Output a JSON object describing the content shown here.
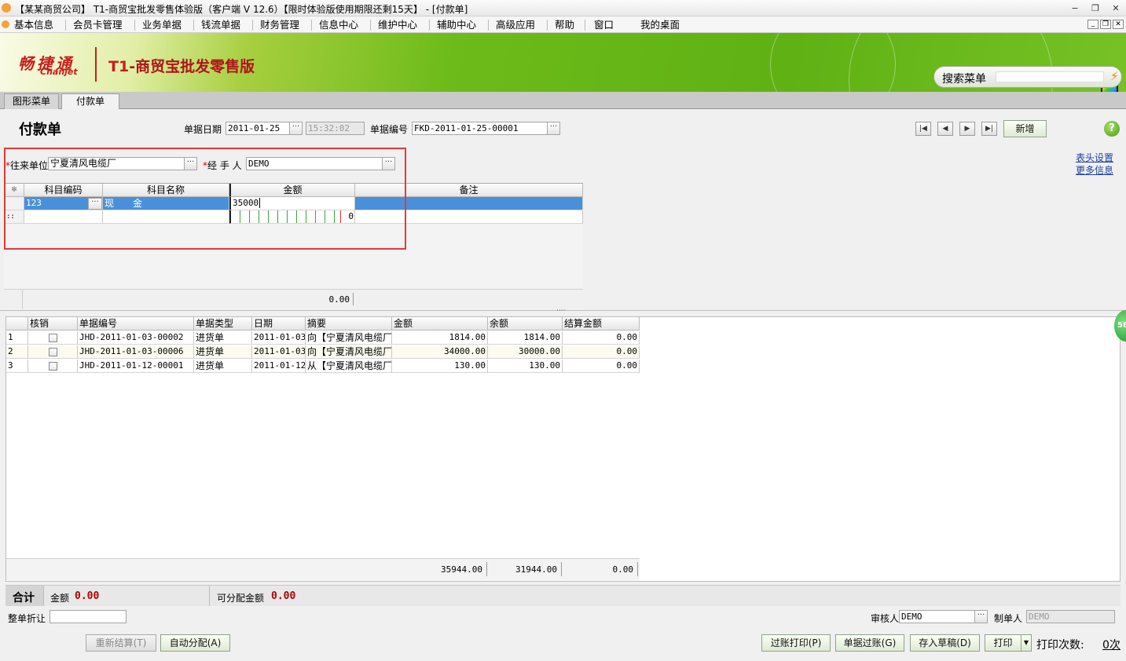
{
  "window": {
    "title": "【某某商贸公司】 T1-商贸宝批发零售体验版（客户端 V 12.6）【限时体验版使用期限还剩15天】 - [付款单]",
    "controls": {
      "minimize": "−",
      "restore": "❐",
      "close": "✕"
    }
  },
  "menu": {
    "items": [
      "基本信息",
      "会员卡管理",
      "业务单据",
      "钱流单据",
      "财务管理",
      "信息中心",
      "维护中心",
      "辅助中心",
      "高级应用",
      "帮助",
      "窗口",
      "我的桌面"
    ]
  },
  "banner": {
    "brand_cn": "畅捷通",
    "brand_en": "Chanjet",
    "product_prefix": "T1",
    "product_name": "-商贸宝批发零售版",
    "search_label": "搜索菜单",
    "search_value": ""
  },
  "tabs": [
    {
      "label": "图形菜单",
      "active": false
    },
    {
      "label": "付款单",
      "active": true
    }
  ],
  "form": {
    "title": "付款单",
    "date_label": "单据日期",
    "date_value": "2011-01-25",
    "time_value": "15:32:02",
    "number_label": "单据编号",
    "number_value": "FKD-2011-01-25-00001",
    "new_button": "新增",
    "help_icon": "?",
    "partner_label": "往来单位",
    "partner_value": "宁夏清风电缆厂",
    "handler_label": "经 手 人",
    "handler_value": "DEMO",
    "required_mark": "*",
    "link_header_settings": "表头设置",
    "link_more_info": "更多信息",
    "ellipsis": "···"
  },
  "entry_grid": {
    "corner": "✻",
    "columns": [
      "科目编码",
      "科目名称",
      "金额",
      "备注"
    ],
    "rows": [
      {
        "code": "123",
        "name": "现　　金",
        "amount": "35000",
        "note": ""
      }
    ],
    "new_row_marker": "::",
    "new_row_amount": "0",
    "footer_amount": "0.00"
  },
  "bill_grid": {
    "columns": [
      "",
      "核销",
      "单据编号",
      "单据类型",
      "日期",
      "摘要",
      "金额",
      "余额",
      "结算金额"
    ],
    "rows": [
      {
        "idx": "1",
        "checked": false,
        "number": "JHD-2011-01-03-00002",
        "type": "进货单",
        "date": "2011-01-03",
        "summary": "向【宁夏清风电缆厂",
        "amount": "1814.00",
        "balance": "1814.00",
        "settle": "0.00"
      },
      {
        "idx": "2",
        "checked": false,
        "number": "JHD-2011-01-03-00006",
        "type": "进货单",
        "date": "2011-01-03",
        "summary": "向【宁夏清风电缆厂",
        "amount": "34000.00",
        "balance": "30000.00",
        "settle": "0.00"
      },
      {
        "idx": "3",
        "checked": false,
        "number": "JHD-2011-01-12-00001",
        "type": "进货单",
        "date": "2011-01-12",
        "summary": "从【宁夏清风电缆厂",
        "amount": "130.00",
        "balance": "130.00",
        "settle": "0.00"
      }
    ],
    "totals": {
      "amount": "35944.00",
      "balance": "31944.00",
      "settle": "0.00"
    }
  },
  "summary": {
    "total_label": "合计",
    "amount_label": "金额",
    "amount_value": "0.00",
    "distributable_label": "可分配金额",
    "distributable_value": "0.00"
  },
  "footer": {
    "discount_label": "整单折让",
    "discount_value": "",
    "reviewer_label": "审核人",
    "reviewer_value": "DEMO",
    "maker_label": "制单人",
    "maker_value": "DEMO",
    "btn_recalc": "重新结算(T)",
    "btn_auto": "自动分配(A)",
    "btn_post_print": "过账打印(P)",
    "btn_post": "单据过账(G)",
    "btn_draft": "存入草稿(D)",
    "btn_print": "打印",
    "print_count_label": "打印次数:",
    "print_count_value": "0次"
  },
  "side_badge": "58",
  "colors": {
    "selection": "#4a90d9",
    "banner_green": "#5fb114",
    "brand_red": "#c81d1d",
    "annotation_red": "#e23a3a"
  }
}
